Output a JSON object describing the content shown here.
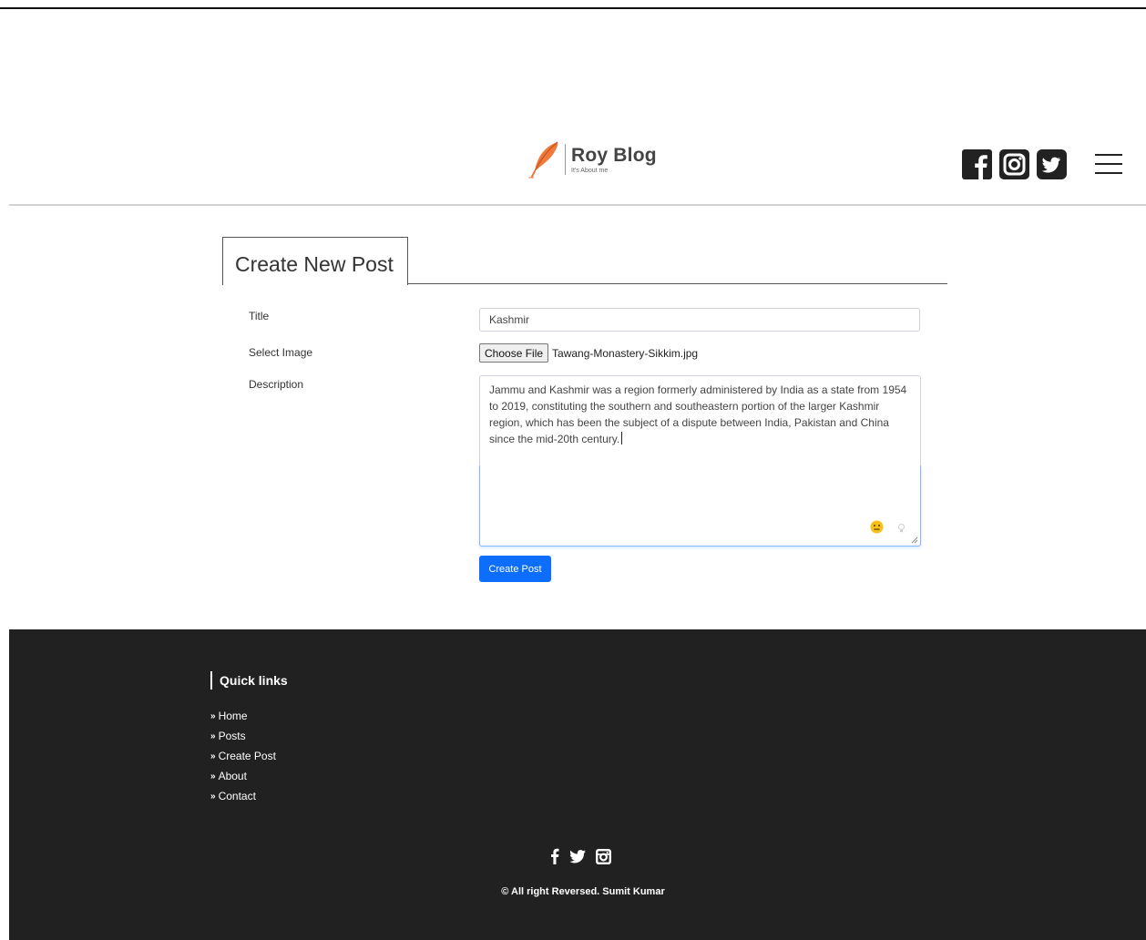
{
  "brand": {
    "title": "Roy Blog",
    "tagline": "It's About me",
    "accent_color": "#f07a3c"
  },
  "header": {
    "social_icons": [
      "facebook-icon",
      "instagram-icon",
      "twitter-icon"
    ],
    "menu_icon": "hamburger-menu-icon"
  },
  "form": {
    "heading": "Create New Post",
    "title_label": "Title",
    "title_value": "Kashmir",
    "image_label": "Select Image",
    "choose_file_label": "Choose File",
    "file_name": "Tawang-Monastery-Sikkim.jpg",
    "description_label": "Description",
    "description_value": "Jammu and Kashmir was a region formerly administered by India as a state from 1954 to 2019, constituting the southern and southeastern portion of the larger Kashmir region, which has been the subject of a dispute between India, Pakistan and China since the mid-20th century.",
    "submit_label": "Create Post",
    "submit_color": "#0d6efd"
  },
  "footer": {
    "quick_links_title": "Quick links",
    "links": [
      {
        "label": "Home"
      },
      {
        "label": "Posts"
      },
      {
        "label": "Create Post"
      },
      {
        "label": "About"
      },
      {
        "label": "Contact"
      }
    ],
    "social_icons": [
      "facebook-icon",
      "twitter-icon",
      "instagram-icon"
    ],
    "copyright": "© All right Reversed.  Sumit Kumar",
    "background_color": "#212121"
  }
}
